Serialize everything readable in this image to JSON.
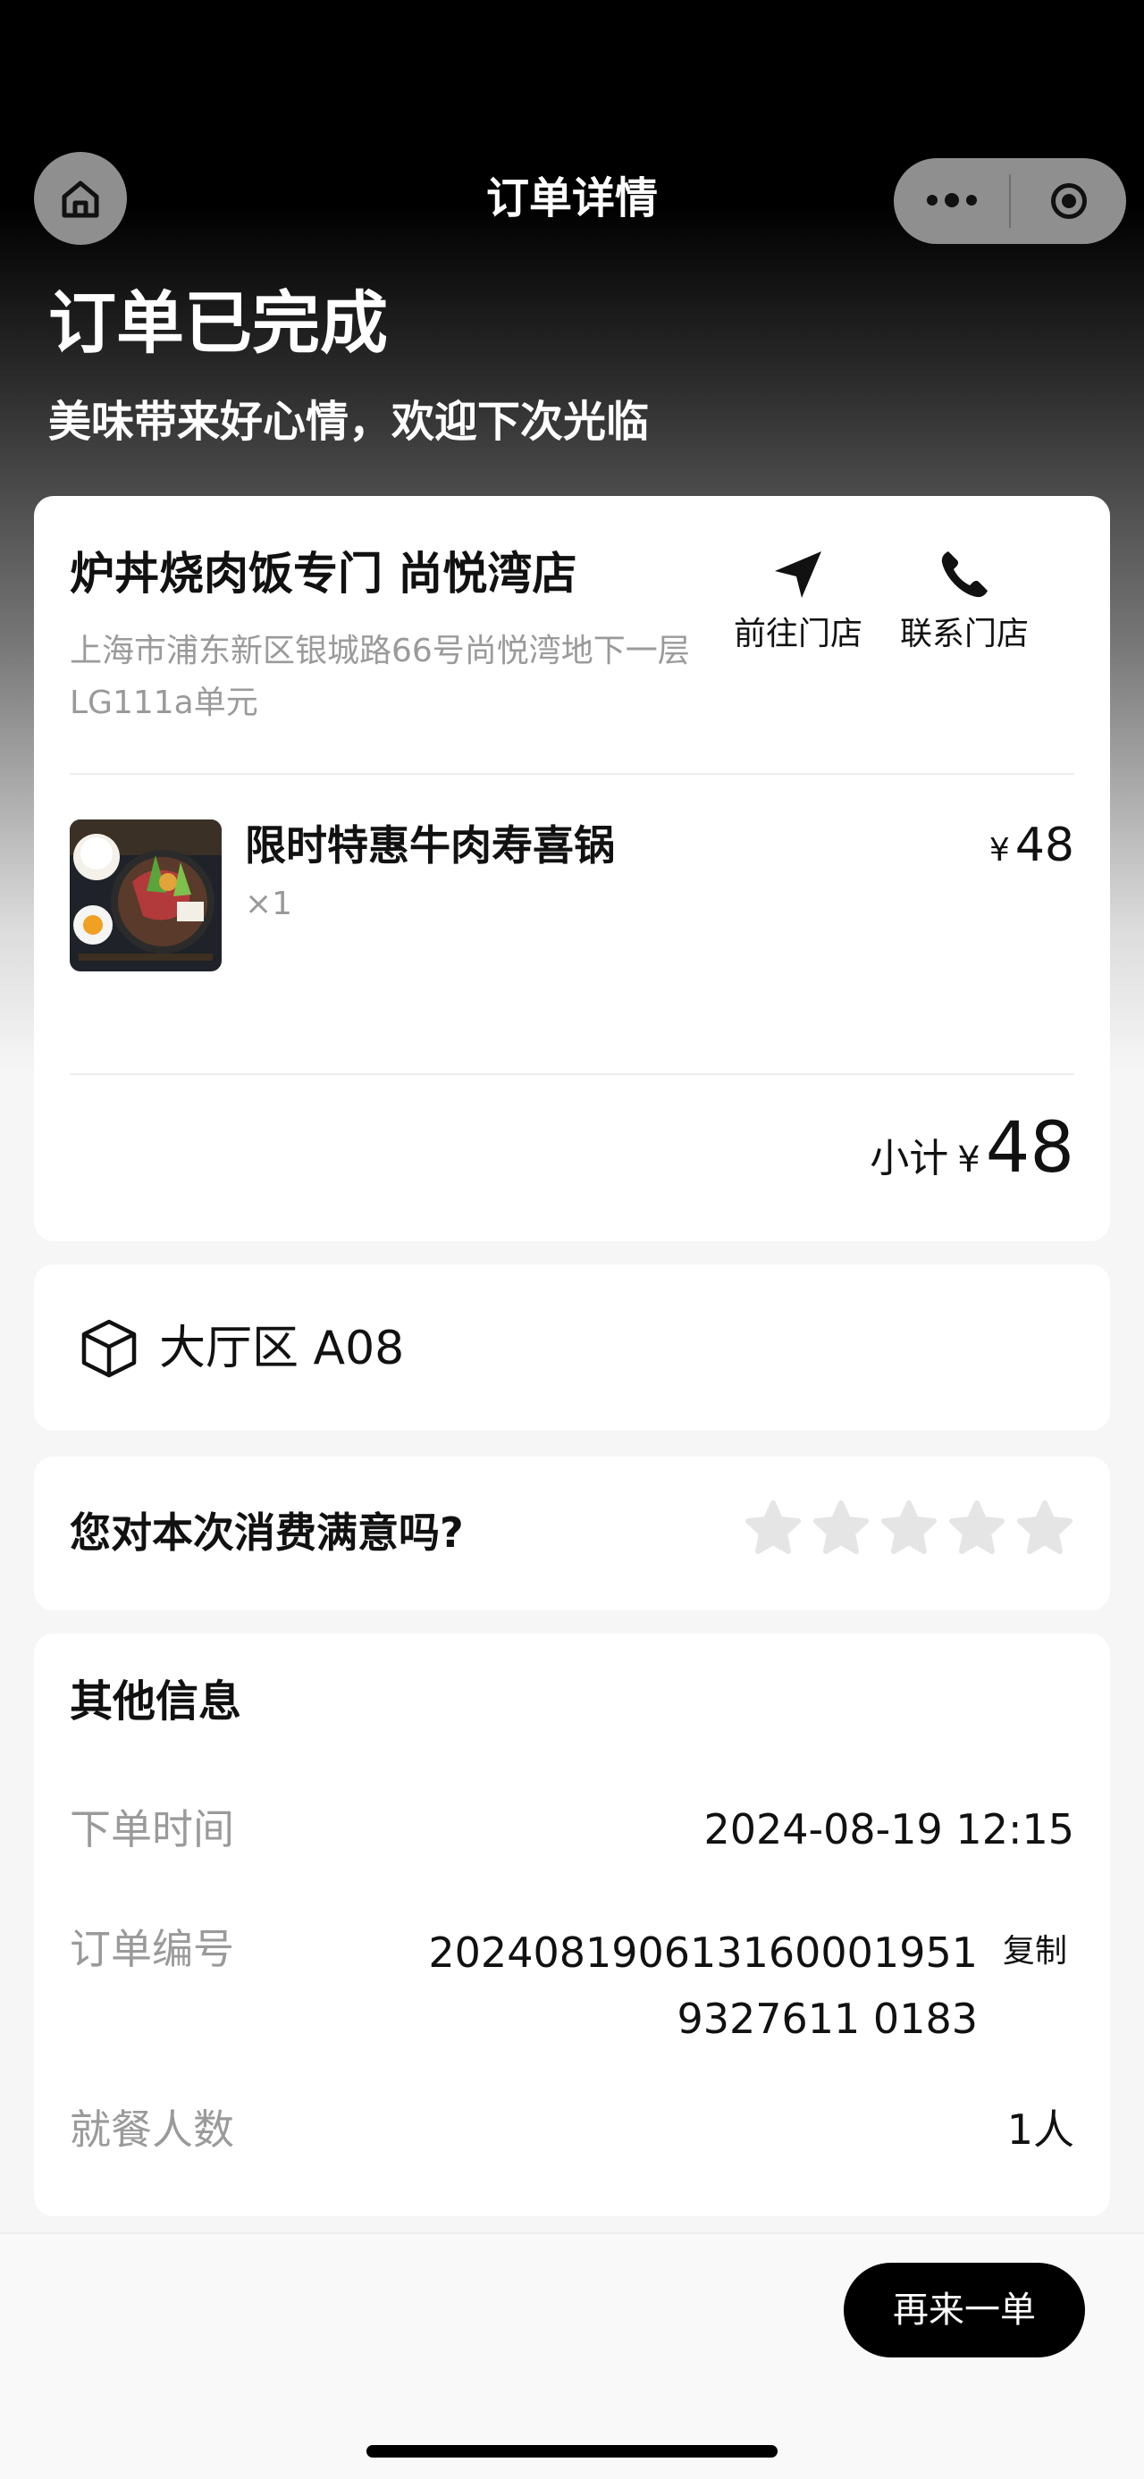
{
  "nav": {
    "title": "订单详情",
    "home_icon": "home-icon",
    "more_icon": "more-dots-icon",
    "close_icon": "target-close-icon"
  },
  "status": {
    "title": "订单已完成",
    "subtitle": "美味带来好心情，欢迎下次光临"
  },
  "store": {
    "name": "炉丼烧肉饭专门 尚悦湾店",
    "address": "上海市浦东新区银城路66号尚悦湾地下一层LG111a单元",
    "actions": {
      "navigate_label": "前往门店",
      "call_label": "联系门店"
    }
  },
  "items": [
    {
      "name": "限时特惠牛肉寿喜锅",
      "qty": "×1",
      "currency": "¥",
      "price": "48"
    }
  ],
  "subtotal": {
    "label": "小计",
    "currency": "¥",
    "amount": "48"
  },
  "table": {
    "label": "大厅区 A08"
  },
  "rating": {
    "question": "您对本次消费满意吗?",
    "max_stars": 5,
    "selected": 0
  },
  "info": {
    "title": "其他信息",
    "order_time_label": "下单时间",
    "order_time": "2024-08-19 12:15",
    "order_no_label": "订单编号",
    "order_no": "2024081906131600019519327611 0183",
    "copy_label": "复制",
    "diners_label": "就餐人数",
    "diners": "1人"
  },
  "footer": {
    "reorder_label": "再来一单"
  },
  "colors": {
    "accent": "#000000",
    "muted_text": "#9a9a9a",
    "card_bg": "#ffffff",
    "star_empty": "#e5e5e5"
  }
}
